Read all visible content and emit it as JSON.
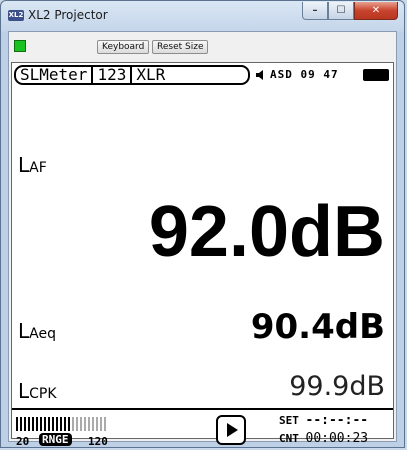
{
  "window": {
    "title": "XL2 Projector",
    "app_icon_text": "XL2",
    "controls": {
      "minimize": "–",
      "maximize": "☐",
      "close": "✕"
    }
  },
  "toolbar": {
    "keyboard_label": "Keyboard",
    "reset_size_label": "Reset Size",
    "status_led_color": "#19c21e"
  },
  "display": {
    "tabs": [
      "SLMeter",
      "123",
      "XLR"
    ],
    "status_text": "ASD 09 47",
    "icons": {
      "speaker": "speaker-icon",
      "battery": "battery-icon"
    },
    "readings": [
      {
        "label": "L",
        "sub": "AF",
        "value": "92.0dB"
      },
      {
        "label": "L",
        "sub": "Aeq",
        "value": "90.4dB"
      },
      {
        "label": "L",
        "sub": "CPK",
        "value": "99.9dB"
      }
    ],
    "level_bar": {
      "lit": 14,
      "total": 23
    },
    "range": {
      "low": "20",
      "label": "RNGE",
      "high": "120"
    },
    "timer": {
      "set_label": "SET",
      "set_value": "--:--:--",
      "cnt_label": "CNT",
      "cnt_value": "00:00:23"
    }
  }
}
